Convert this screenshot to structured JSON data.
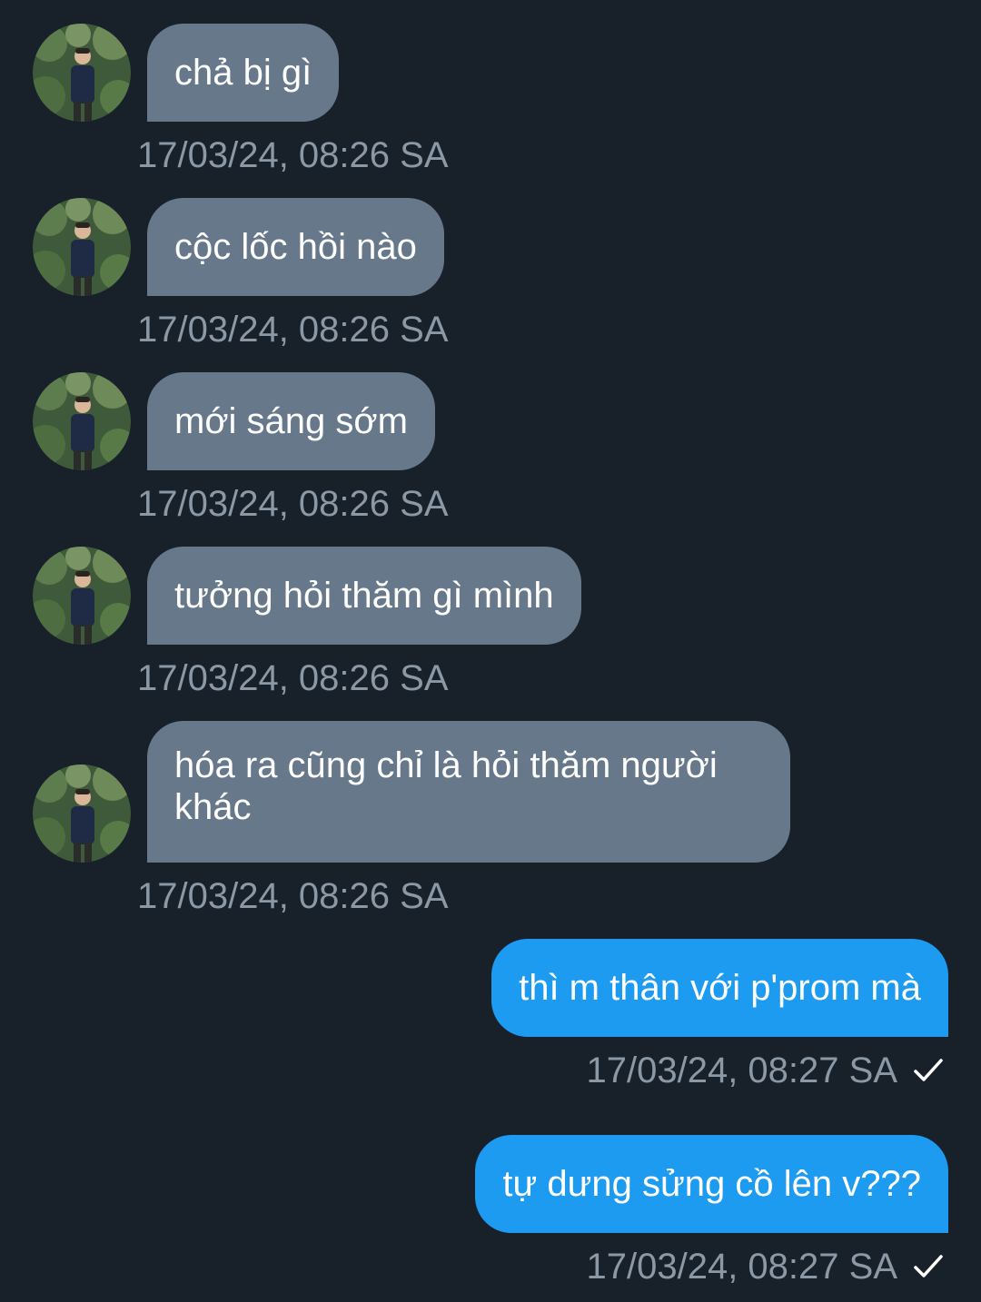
{
  "messages": [
    {
      "direction": "in",
      "text": "chả bị gì",
      "time": "17/03/24, 08:26 SA"
    },
    {
      "direction": "in",
      "text": "cộc lốc hồi nào",
      "time": "17/03/24, 08:26 SA"
    },
    {
      "direction": "in",
      "text": "mới sáng sớm",
      "time": "17/03/24, 08:26 SA"
    },
    {
      "direction": "in",
      "text": "tưởng hỏi thăm gì mình",
      "time": "17/03/24, 08:26 SA"
    },
    {
      "direction": "in",
      "text": "hóa ra cũng chỉ là hỏi thăm người khác",
      "time": "17/03/24, 08:26 SA"
    },
    {
      "direction": "out",
      "text": "thì m thân với p'prom mà",
      "time": "17/03/24, 08:27 SA",
      "status": "sent-checkmark-icon"
    },
    {
      "direction": "out",
      "text": "tự dưng sửng cồ lên v???",
      "time": "17/03/24, 08:27 SA",
      "status": "sent-checkmark-icon"
    }
  ],
  "colors": {
    "background": "#18202a",
    "incoming_bubble": "#66788a",
    "outgoing_bubble": "#1d9bf0",
    "timestamp": "#8b98a5",
    "text": "#ffffff"
  }
}
